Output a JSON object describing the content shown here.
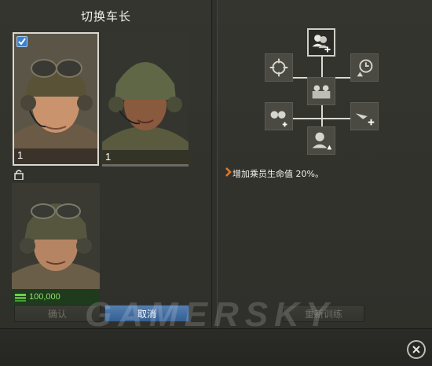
{
  "dialog": {
    "title": "切换车长",
    "confirm_label": "确认",
    "cancel_label": "取消",
    "retrain_label": "重新训练"
  },
  "crew": [
    {
      "name": "commander-1",
      "level": "1",
      "selected": true
    },
    {
      "name": "commander-2",
      "level": "1",
      "selected": false
    },
    {
      "name": "commander-3",
      "price": "100,000"
    }
  ],
  "skill": {
    "description": "增加乘员生命值 20%。"
  },
  "watermark": "GAMERSKY",
  "colors": {
    "accent": "#3c7fcf",
    "price_green": "#8fe06a",
    "desc_arrow": "#e07a2a"
  }
}
